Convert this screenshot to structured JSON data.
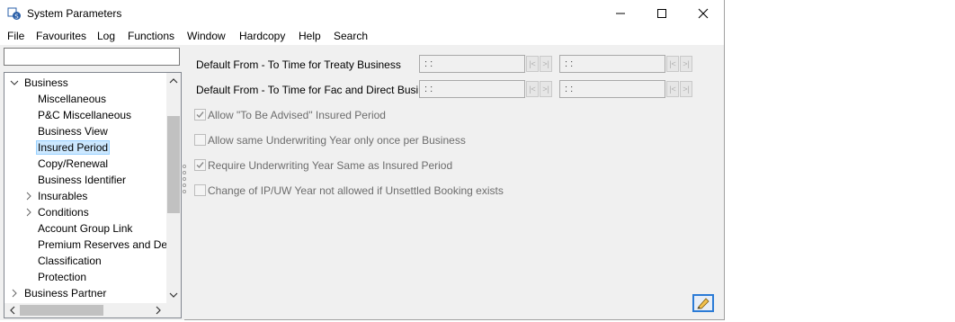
{
  "window": {
    "title": "System Parameters"
  },
  "menu": [
    "File",
    "Favourites",
    "Log",
    "Functions",
    "Window",
    "Hardcopy",
    "Help",
    "Search"
  ],
  "search": {
    "value": ""
  },
  "tree": [
    {
      "label": "Business",
      "expander": "expanded"
    },
    {
      "label": "Miscellaneous"
    },
    {
      "label": "P&C Miscellaneous"
    },
    {
      "label": "Business View"
    },
    {
      "label": "Insured Period",
      "selected": true
    },
    {
      "label": "Copy/Renewal"
    },
    {
      "label": "Business Identifier"
    },
    {
      "label": "Insurables",
      "expander": "collapsed"
    },
    {
      "label": "Conditions",
      "expander": "collapsed"
    },
    {
      "label": "Account Group Link"
    },
    {
      "label": "Premium Reserves and Depos"
    },
    {
      "label": "Classification"
    },
    {
      "label": "Protection"
    },
    {
      "label": "Business Partner",
      "expander": "collapsed"
    }
  ],
  "fields": [
    {
      "label": "Default From - To Time for Treaty Business",
      "from": ": :",
      "to": ": :"
    },
    {
      "label": "Default From - To Time for Fac and Direct Business",
      "from": ": :",
      "to": ": :"
    }
  ],
  "checkboxes": [
    {
      "label": "Allow \"To Be Advised\" Insured Period",
      "checked": true
    },
    {
      "label": "Allow same Underwriting Year only once per Business",
      "checked": false
    },
    {
      "label": "Require Underwriting Year Same as Insured Period",
      "checked": true
    },
    {
      "label": "Change of IP/UW Year not allowed if Unsettled Booking exists",
      "checked": false
    }
  ],
  "nav_glyphs": {
    "first": "|<",
    "last": ">|"
  },
  "colors": {
    "selection": "#cce8ff",
    "accent": "#2b7bd6"
  }
}
